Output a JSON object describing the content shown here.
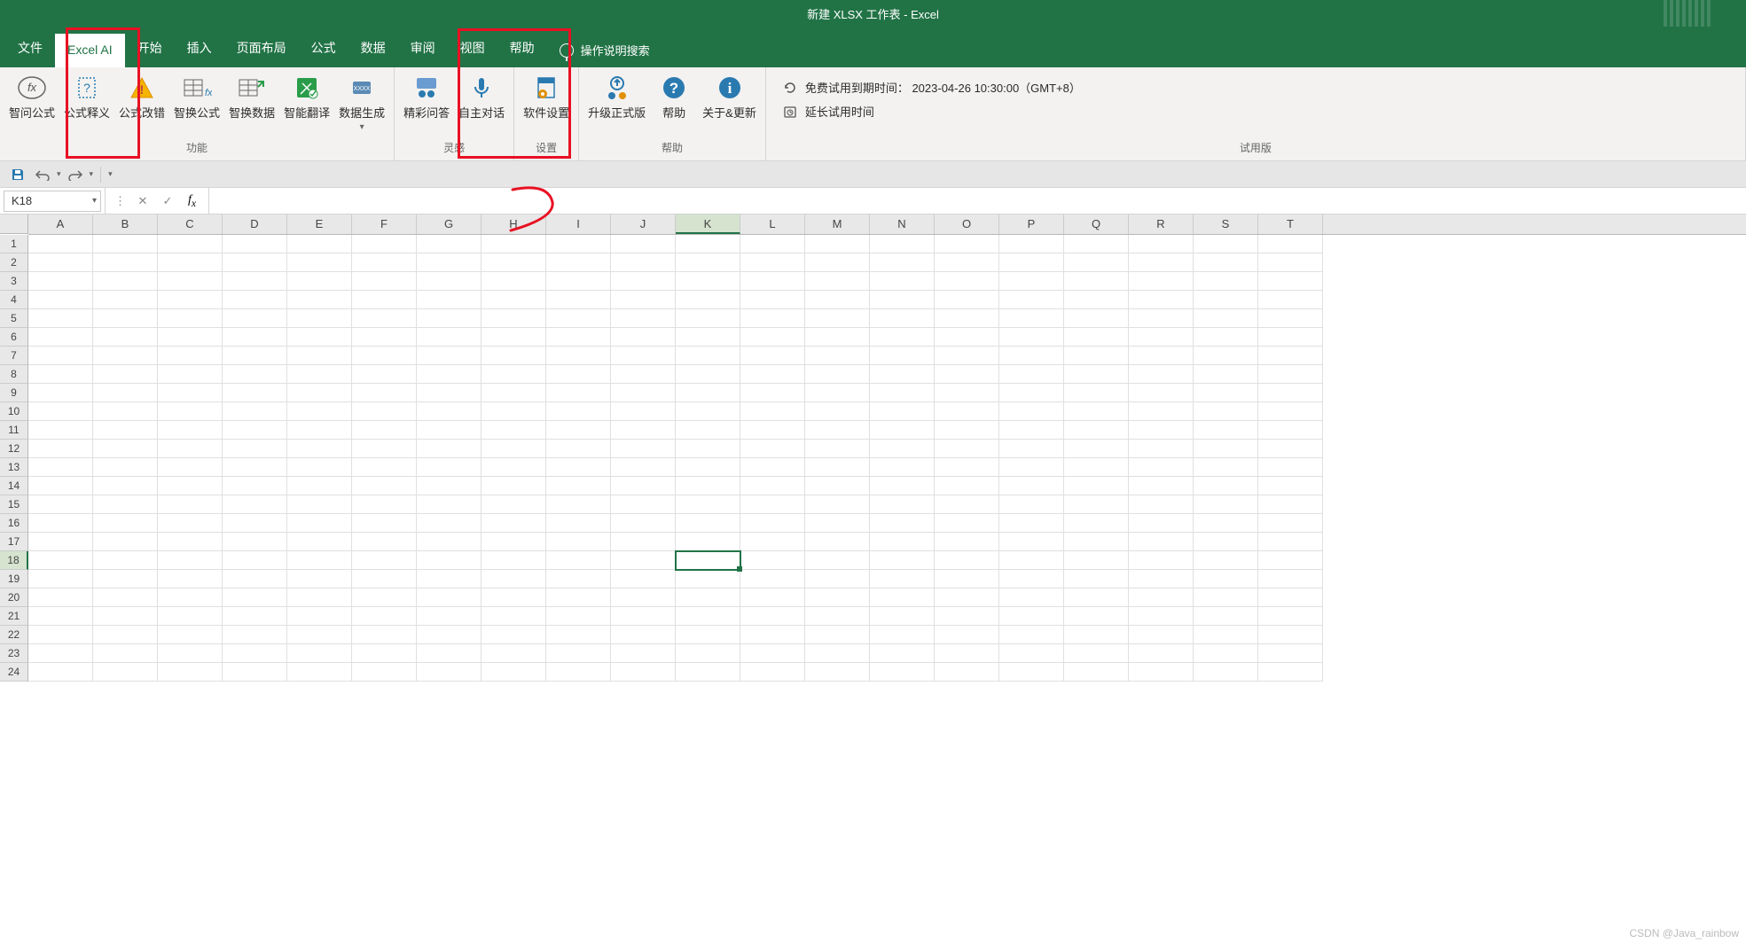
{
  "title": "新建 XLSX 工作表  -  Excel",
  "tabs": {
    "file": "文件",
    "excel_ai": "Excel AI",
    "start": "开始",
    "insert": "插入",
    "layout": "页面布局",
    "formula": "公式",
    "data": "数据",
    "review": "审阅",
    "view": "视图",
    "help": "帮助",
    "search_hint": "操作说明搜索"
  },
  "ribbon": {
    "group_function": "功能",
    "group_inspiration": "灵感",
    "group_settings": "设置",
    "group_help": "帮助",
    "group_trial": "试用版",
    "btn_smart_ask": "智问公式",
    "btn_explain": "公式释义",
    "btn_correct": "公式改错",
    "btn_convert_formula": "智换公式",
    "btn_convert_data": "智换数据",
    "btn_translate": "智能翻译",
    "btn_data_gen": "数据生成",
    "btn_qa": "精彩问答",
    "btn_dialog": "自主对话",
    "btn_settings": "软件设置",
    "btn_upgrade": "升级正式版",
    "btn_help": "帮助",
    "btn_about": "关于&更新",
    "trial_expiry": "免费试用到期时间：  2023-04-26 10:30:00（GMT+8）",
    "trial_extend": "延长试用时间"
  },
  "namebox": "K18",
  "columns": [
    "A",
    "B",
    "C",
    "D",
    "E",
    "F",
    "G",
    "H",
    "I",
    "J",
    "K",
    "L",
    "M",
    "N",
    "O",
    "P",
    "Q",
    "R",
    "S",
    "T"
  ],
  "rows": [
    "1",
    "2",
    "3",
    "4",
    "5",
    "6",
    "7",
    "8",
    "9",
    "10",
    "11",
    "12",
    "13",
    "14",
    "15",
    "16",
    "17",
    "18",
    "19",
    "20",
    "21",
    "22",
    "23",
    "24"
  ],
  "selected": {
    "row": "18",
    "col": "K"
  },
  "watermark": "CSDN @Java_rainbow"
}
